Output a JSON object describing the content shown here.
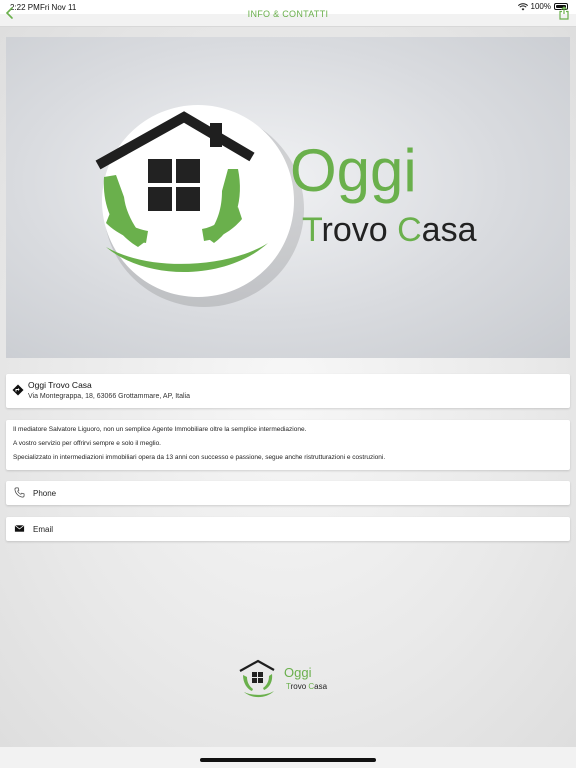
{
  "status_bar": {
    "time": "2:22 PM",
    "date": "Fri Nov 11",
    "battery": "100%"
  },
  "navbar": {
    "title": "INFO & CONTATTI"
  },
  "brand": {
    "line1": "Oggi",
    "line2_word1_first": "T",
    "line2_word1_rest": "rovo ",
    "line2_word2_first": "C",
    "line2_word2_rest": "asa",
    "colors": {
      "green": "#6ab04c",
      "dark": "#222222"
    }
  },
  "address": {
    "name": "Oggi Trovo Casa",
    "line": "Via Montegrappa, 18, 63066 Grottammare, AP, Italia"
  },
  "description": {
    "lines": [
      "Il mediatore Salvatore Liguoro, non un semplice Agente Immobiliare oltre la semplice intermediazione.",
      "A vostro servizio per offrirvi sempre e solo il meglio.",
      "Specializzato in intermediazioni immobiliari opera da 13 anni con successo e passione, segue anche ristrutturazioni e costruzioni."
    ]
  },
  "contacts": {
    "phone_label": "Phone",
    "email_label": "Email"
  },
  "icons": {
    "back": "chevron-left-icon",
    "share": "share-icon",
    "directions": "directions-icon",
    "phone": "phone-icon",
    "email": "envelope-icon",
    "wifi": "wifi-icon",
    "battery": "battery-icon"
  }
}
